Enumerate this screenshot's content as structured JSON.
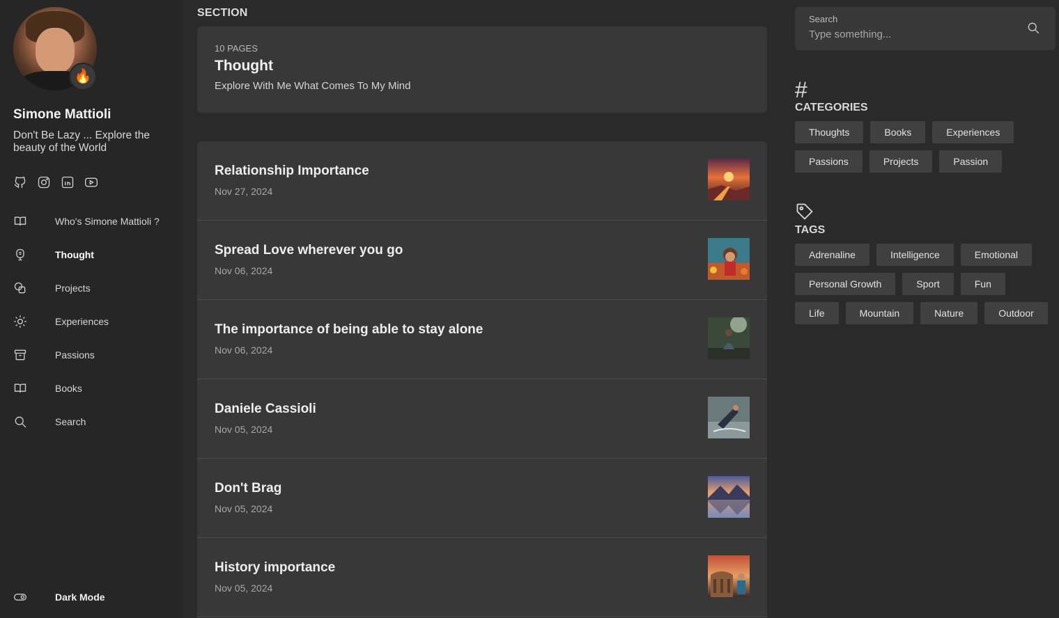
{
  "profile": {
    "name": "Simone Mattioli",
    "tagline": "Don't Be Lazy ... Explore the beauty of the World",
    "badge": "🔥"
  },
  "socials": [
    "github-icon",
    "instagram-icon",
    "linkedin-icon",
    "youtube-icon"
  ],
  "nav": {
    "items": [
      {
        "label": "Who's Simone Mattioli ?",
        "icon": "book-open-icon",
        "active": false
      },
      {
        "label": "Thought",
        "icon": "brain-icon",
        "active": true
      },
      {
        "label": "Projects",
        "icon": "shapes-icon",
        "active": false
      },
      {
        "label": "Experiences",
        "icon": "lightbulb-icon",
        "active": false
      },
      {
        "label": "Passions",
        "icon": "archive-icon",
        "active": false
      },
      {
        "label": "Books",
        "icon": "book-icon",
        "active": false
      },
      {
        "label": "Search",
        "icon": "search-icon",
        "active": false
      }
    ],
    "dark_mode_label": "Dark Mode"
  },
  "main": {
    "section_label": "SECTION",
    "header": {
      "count": "10 PAGES",
      "title": "Thought",
      "subtitle": "Explore With Me What Comes To My Mind"
    },
    "posts": [
      {
        "title": "Relationship Importance",
        "date": "Nov 27, 2024"
      },
      {
        "title": "Spread Love wherever you go",
        "date": "Nov 06, 2024"
      },
      {
        "title": "The importance of being able to stay alone",
        "date": "Nov 06, 2024"
      },
      {
        "title": "Daniele Cassioli",
        "date": "Nov 05, 2024"
      },
      {
        "title": "Don't Brag",
        "date": "Nov 05, 2024"
      },
      {
        "title": "History importance",
        "date": "Nov 05, 2024"
      }
    ]
  },
  "search": {
    "label": "Search",
    "placeholder": "Type something..."
  },
  "categories": {
    "title": "CATEGORIES",
    "icon": "#",
    "items": [
      "Thoughts",
      "Books",
      "Experiences",
      "Passions",
      "Projects",
      "Passion"
    ]
  },
  "tags": {
    "title": "TAGS",
    "items": [
      "Adrenaline",
      "Intelligence",
      "Emotional",
      "Personal Growth",
      "Sport",
      "Fun",
      "Life",
      "Mountain",
      "Nature",
      "Outdoor"
    ]
  },
  "colors": {
    "background": "#2a2a2a",
    "sidebar": "#262626",
    "card": "#383838",
    "chip": "#404040"
  }
}
